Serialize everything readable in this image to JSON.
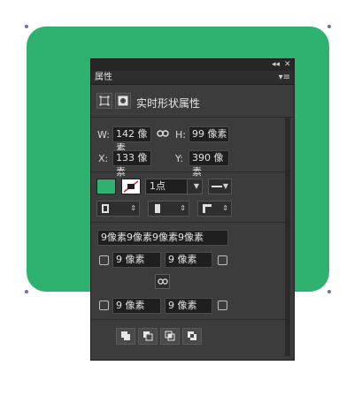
{
  "shape": {
    "fill": "#2fb170"
  },
  "panel": {
    "tab_label": "属性",
    "collapse_label": "◂◂",
    "close_label": "✕",
    "menu_label": "▾≡",
    "header": {
      "title": "实时形状属性"
    },
    "geometry": {
      "w_label": "W:",
      "w_value": "142 像素",
      "h_label": "H:",
      "h_value": "99 像素",
      "x_label": "X:",
      "x_value": "133 像素",
      "y_label": "Y:",
      "y_value": "390 像素"
    },
    "stroke": {
      "fill_color": "#2fb170",
      "width_value": "1点"
    },
    "corners": {
      "all_value": "9像素9像素9像素9像素",
      "tl_value": "9 像素",
      "tr_value": "9 像素",
      "bl_value": "9 像素",
      "br_value": "9 像素"
    }
  }
}
